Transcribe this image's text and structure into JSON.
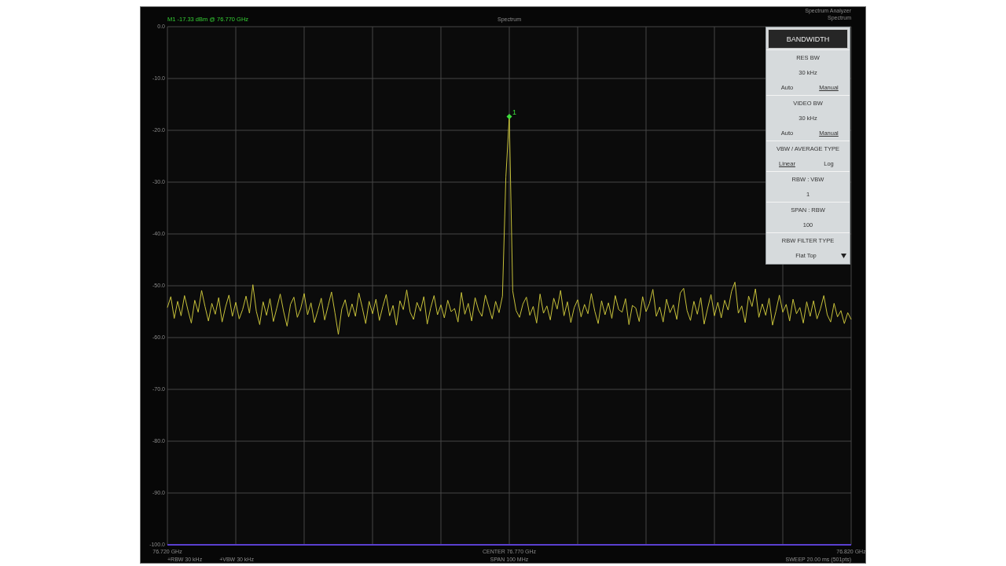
{
  "header": {
    "marker_readout": "M1 -17.33 dBm @ 76.770 GHz",
    "title": "Spectrum",
    "instrument": "Spectrum Analyzer",
    "mode": "Spectrum"
  },
  "chart": {
    "chart_data": {
      "type": "line",
      "grid": true,
      "xlim": [
        76.72,
        76.82
      ],
      "xticks": [
        {
          "value": 76.72,
          "label": "76.720 GHz"
        },
        {
          "value": 76.77,
          "label": "CENTER 76.770 GHz"
        },
        {
          "value": 76.82,
          "label": "76.820 GHz"
        }
      ],
      "ylim": [
        -100,
        0
      ],
      "yticks": [
        {
          "value": 0,
          "label": "0.0"
        },
        {
          "value": -10,
          "label": "-10.0"
        },
        {
          "value": -20,
          "label": "-20.0"
        },
        {
          "value": -30,
          "label": "-30.0"
        },
        {
          "value": -40,
          "label": "-40.0"
        },
        {
          "value": -50,
          "label": "-50.0"
        },
        {
          "value": -60,
          "label": "-60.0"
        },
        {
          "value": -70,
          "label": "-70.0"
        },
        {
          "value": -80,
          "label": "-80.0"
        },
        {
          "value": -90,
          "label": "-90.0"
        },
        {
          "value": -100,
          "label": "-100.0"
        }
      ],
      "x": [
        76.72,
        76.7205,
        76.721,
        76.7215,
        76.722,
        76.7225,
        76.723,
        76.7235,
        76.724,
        76.7245,
        76.725,
        76.7255,
        76.726,
        76.7265,
        76.727,
        76.7275,
        76.728,
        76.7285,
        76.729,
        76.7295,
        76.73,
        76.7305,
        76.731,
        76.7315,
        76.732,
        76.7325,
        76.733,
        76.7335,
        76.734,
        76.7345,
        76.735,
        76.7355,
        76.736,
        76.7365,
        76.737,
        76.7375,
        76.738,
        76.7385,
        76.739,
        76.7395,
        76.74,
        76.7405,
        76.741,
        76.7415,
        76.742,
        76.7425,
        76.743,
        76.7435,
        76.744,
        76.7445,
        76.745,
        76.7455,
        76.746,
        76.7465,
        76.747,
        76.7475,
        76.748,
        76.7485,
        76.749,
        76.7495,
        76.75,
        76.7505,
        76.751,
        76.7515,
        76.752,
        76.7525,
        76.753,
        76.7535,
        76.754,
        76.7545,
        76.755,
        76.7555,
        76.756,
        76.7565,
        76.757,
        76.7575,
        76.758,
        76.7585,
        76.759,
        76.7595,
        76.76,
        76.7605,
        76.761,
        76.7615,
        76.762,
        76.7625,
        76.763,
        76.7635,
        76.764,
        76.7645,
        76.765,
        76.7655,
        76.766,
        76.7665,
        76.767,
        76.7675,
        76.768,
        76.7685,
        76.769,
        76.7695,
        76.77,
        76.7705,
        76.771,
        76.7715,
        76.772,
        76.7725,
        76.773,
        76.7735,
        76.774,
        76.7745,
        76.775,
        76.7755,
        76.776,
        76.7765,
        76.777,
        76.7775,
        76.778,
        76.7785,
        76.779,
        76.7795,
        76.78,
        76.7805,
        76.781,
        76.7815,
        76.782,
        76.7825,
        76.783,
        76.7835,
        76.784,
        76.7845,
        76.785,
        76.7855,
        76.786,
        76.7865,
        76.787,
        76.7875,
        76.788,
        76.7885,
        76.789,
        76.7895,
        76.79,
        76.7905,
        76.791,
        76.7915,
        76.792,
        76.7925,
        76.793,
        76.7935,
        76.794,
        76.7945,
        76.795,
        76.7955,
        76.796,
        76.7965,
        76.797,
        76.7975,
        76.798,
        76.7985,
        76.799,
        76.7995,
        76.8,
        76.8005,
        76.801,
        76.8015,
        76.802,
        76.8025,
        76.803,
        76.8035,
        76.804,
        76.8045,
        76.805,
        76.8055,
        76.806,
        76.8065,
        76.807,
        76.8075,
        76.808,
        76.8085,
        76.809,
        76.8095,
        76.81,
        76.8105,
        76.811,
        76.8115,
        76.812,
        76.8125,
        76.813,
        76.8135,
        76.814,
        76.8145,
        76.815,
        76.8155,
        76.816,
        76.8165,
        76.817,
        76.8175,
        76.818,
        76.8185,
        76.819,
        76.8195,
        76.82
      ],
      "series": [
        {
          "color": "#c8c23a",
          "values": [
            -54.2,
            -52.1,
            -56.3,
            -53.0,
            -55.8,
            -51.9,
            -54.7,
            -57.2,
            -52.8,
            -55.1,
            -50.9,
            -54.0,
            -56.8,
            -53.4,
            -55.5,
            -52.3,
            -57.0,
            -54.1,
            -51.8,
            -55.9,
            -53.2,
            -56.4,
            -54.6,
            -52.0,
            -55.3,
            -49.8,
            -54.9,
            -57.5,
            -53.1,
            -55.7,
            -52.5,
            -56.9,
            -54.3,
            -51.6,
            -55.0,
            -57.8,
            -53.6,
            -52.2,
            -56.1,
            -54.4,
            -51.5,
            -55.6,
            -53.3,
            -57.1,
            -54.8,
            -52.4,
            -56.6,
            -53.9,
            -51.2,
            -55.2,
            -59.4,
            -54.5,
            -52.7,
            -56.0,
            -53.5,
            -55.9,
            -51.4,
            -54.2,
            -57.3,
            -53.0,
            -55.4,
            -52.6,
            -56.7,
            -54.0,
            -51.7,
            -55.8,
            -53.8,
            -57.6,
            -52.9,
            -54.6,
            -50.8,
            -55.1,
            -56.5,
            -53.2,
            -54.9,
            -52.1,
            -57.4,
            -54.3,
            -51.9,
            -55.6,
            -53.7,
            -56.2,
            -52.8,
            -55.0,
            -54.4,
            -57.0,
            -51.3,
            -55.5,
            -53.4,
            -56.8,
            -52.3,
            -54.7,
            -55.9,
            -51.8,
            -54.1,
            -56.4,
            -53.0,
            -55.2,
            -52.0,
            -29.0,
            -17.33,
            -51.0,
            -54.8,
            -56.1,
            -53.5,
            -52.2,
            -55.7,
            -54.0,
            -57.2,
            -51.6,
            -55.3,
            -53.9,
            -56.6,
            -52.4,
            -54.5,
            -50.9,
            -55.8,
            -53.1,
            -57.1,
            -54.2,
            -52.7,
            -56.0,
            -53.6,
            -55.4,
            -51.5,
            -54.9,
            -57.3,
            -52.9,
            -55.6,
            -53.3,
            -56.3,
            -51.9,
            -54.6,
            -55.1,
            -52.5,
            -57.5,
            -53.8,
            -54.3,
            -56.9,
            -52.1,
            -55.0,
            -53.4,
            -50.7,
            -55.9,
            -54.1,
            -57.0,
            -52.6,
            -55.2,
            -53.7,
            -56.5,
            -51.4,
            -50.5,
            -54.8,
            -56.7,
            -53.0,
            -55.5,
            -52.3,
            -57.4,
            -54.4,
            -51.7,
            -55.8,
            -53.2,
            -56.2,
            -52.8,
            -54.7,
            -51.1,
            -49.3,
            -55.3,
            -53.9,
            -57.1,
            -52.0,
            -54.0,
            -50.6,
            -56.1,
            -53.5,
            -55.7,
            -52.4,
            -57.6,
            -54.9,
            -51.8,
            -55.1,
            -53.6,
            -56.8,
            -52.6,
            -55.4,
            -54.2,
            -57.2,
            -53.1,
            -55.9,
            -52.9,
            -56.4,
            -54.5,
            -51.9,
            -55.6,
            -57.0,
            -53.4,
            -56.0,
            -54.8,
            -57.3,
            -55.2,
            -56.5
          ]
        }
      ],
      "annotations": [
        {
          "x": 76.77,
          "y": -17.33,
          "text": "1"
        }
      ]
    }
  },
  "panel": {
    "title": "BANDWIDTH",
    "sections": [
      {
        "kind": "value_options",
        "label": "RES BW",
        "value": "30 kHz",
        "options": [
          {
            "label": "Auto",
            "selected": false
          },
          {
            "label": "Manual",
            "selected": true
          }
        ]
      },
      {
        "kind": "value_options",
        "label": "VIDEO BW",
        "value": "30 kHz",
        "options": [
          {
            "label": "Auto",
            "selected": false
          },
          {
            "label": "Manual",
            "selected": true
          }
        ]
      },
      {
        "kind": "options",
        "label": "VBW / AVERAGE TYPE",
        "options": [
          {
            "label": "Linear",
            "selected": true
          },
          {
            "label": "Log",
            "selected": false
          }
        ]
      },
      {
        "kind": "value",
        "label": "RBW : VBW",
        "value": "1"
      },
      {
        "kind": "value",
        "label": "SPAN : RBW",
        "value": "100"
      },
      {
        "kind": "dropdown",
        "label": "RBW FILTER TYPE",
        "value": "Flat Top"
      }
    ]
  },
  "footer": {
    "rbw": "+RBW 30 kHz",
    "vbw": "+VBW 30 kHz",
    "span": "SPAN 100 MHz",
    "sweep": "SWEEP 20.00 ms (501pts)"
  }
}
